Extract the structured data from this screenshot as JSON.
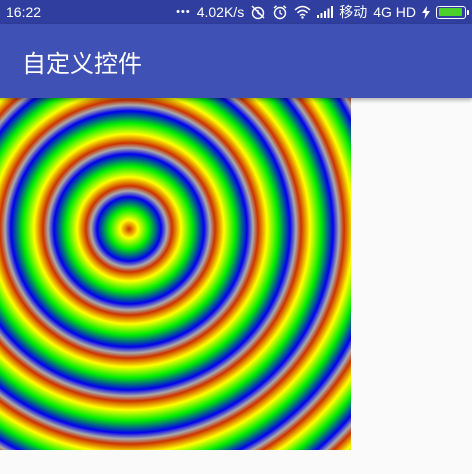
{
  "status_bar": {
    "time": "16:22",
    "dots": "•••",
    "network_speed": "4.02K/s",
    "carrier": "移动",
    "network_type": "4G HD",
    "battery_level": 0.95,
    "battery_color": "#4cd02a",
    "icons": [
      "alarm-off-icon",
      "alarm-icon",
      "wifi-icon",
      "signal-icon",
      "charging-bolt-icon",
      "battery-icon"
    ]
  },
  "app_bar": {
    "title": "自定义控件",
    "background": "#3f51b5"
  },
  "custom_view": {
    "colors": [
      "#cc3300",
      "#ffff00",
      "#00ee00",
      "#0000ee",
      "#aaaaaa"
    ]
  }
}
